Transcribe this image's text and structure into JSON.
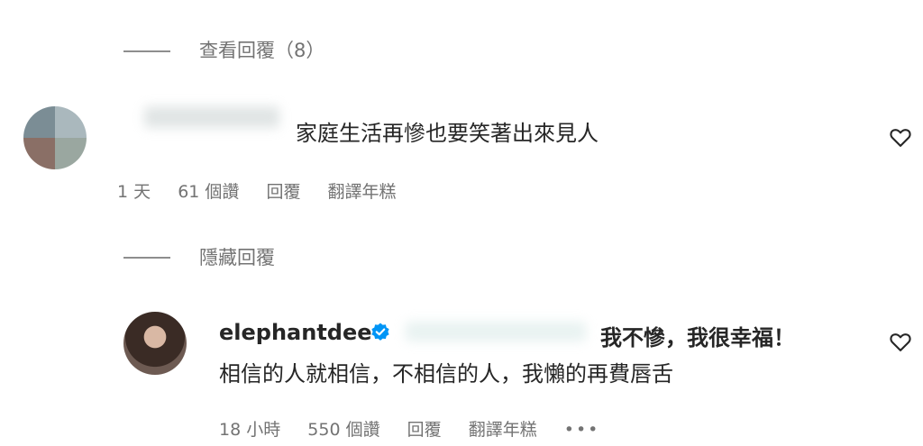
{
  "thread1": {
    "toggle_label": "查看回覆（8）"
  },
  "comment1": {
    "text": "家庭生活再慘也要笑著出來見人",
    "time": "1 天",
    "likes": "61 個讚",
    "reply": "回覆",
    "translate": "翻譯年糕"
  },
  "thread2": {
    "toggle_label": "隱藏回覆"
  },
  "comment2": {
    "username": "elephantdee",
    "text_line1": "我不慘，我很幸福！",
    "text_line2": "相信的人就相信，不相信的人，我懶的再費唇舌",
    "time": "18 小時",
    "likes": "550 個讚",
    "reply": "回覆",
    "translate": "翻譯年糕",
    "more": "•••"
  },
  "colors": {
    "verified": "#0095f6",
    "text": "#262626",
    "muted": "#737373"
  }
}
